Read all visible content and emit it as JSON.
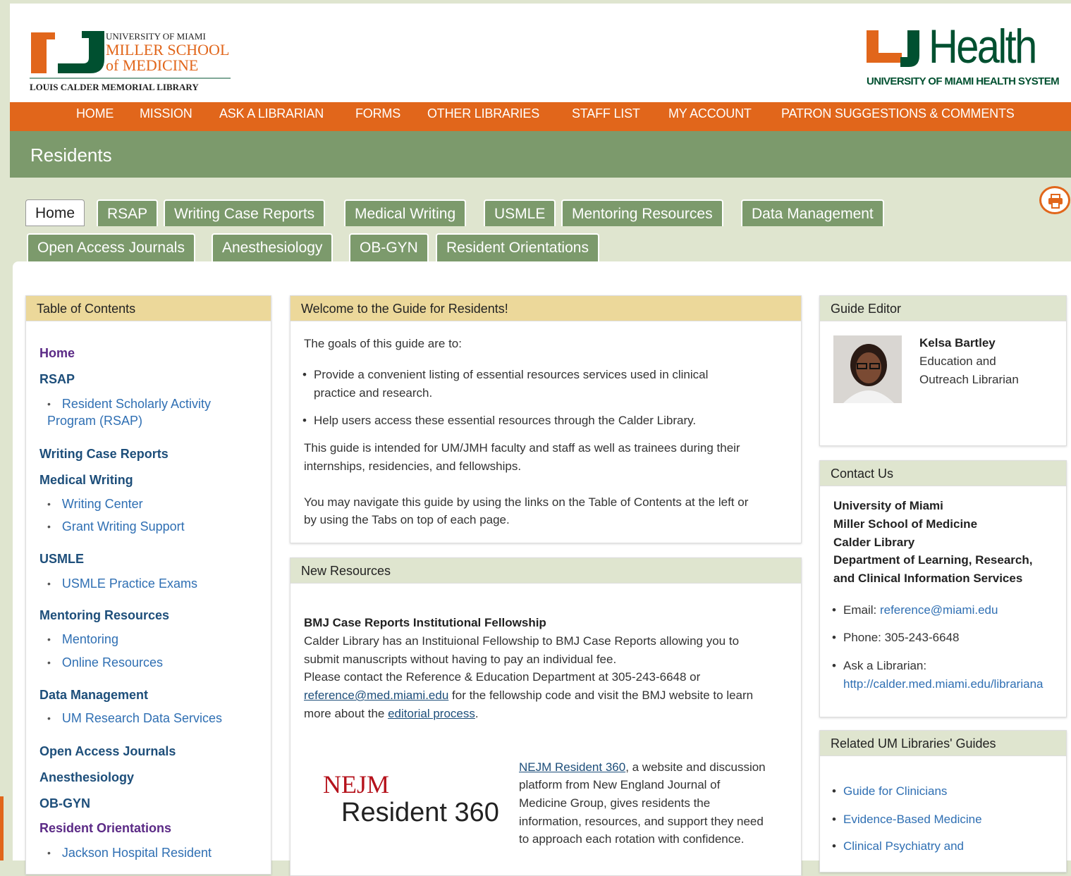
{
  "header": {
    "um_logo": {
      "line1": "UNIVERSITY OF MIAMI",
      "line2": "MILLER SCHOOL",
      "line3": "of MEDICINE",
      "line4": "LOUIS CALDER MEMORIAL LIBRARY"
    },
    "uhealth_logo": {
      "word": "Health",
      "subtitle": "UNIVERSITY OF MIAMI HEALTH SYSTEM"
    }
  },
  "nav": [
    "HOME",
    "MISSION",
    "ASK A LIBRARIAN",
    "FORMS",
    "OTHER LIBRARIES",
    "STAFF LIST",
    "MY ACCOUNT",
    "PATRON SUGGESTIONS & COMMENTS"
  ],
  "page_title": "Residents",
  "tabs_row1": [
    "Home",
    "RSAP",
    "Writing Case Reports",
    "Medical Writing",
    "USMLE",
    "Mentoring Resources",
    "Data Management"
  ],
  "tabs_row2": [
    "Open Access Journals",
    "Anesthesiology",
    "OB-GYN",
    "Resident Orientations"
  ],
  "toc": {
    "title": "Table of Contents",
    "items": {
      "home": "Home",
      "rsap": "RSAP",
      "rsap_sub1a": "Resident Scholarly Activity",
      "rsap_sub1b": "Program (RSAP)",
      "wcr": "Writing Case Reports",
      "mw": "Medical Writing",
      "mw_sub1": "Writing Center",
      "mw_sub2": "Grant Writing Support",
      "usmle": "USMLE",
      "usmle_sub1": "USMLE Practice Exams",
      "mentoring": "Mentoring Resources",
      "mentoring_sub1": "Mentoring",
      "mentoring_sub2": "Online Resources",
      "dm": "Data Management",
      "dm_sub1": "UM Research Data Services",
      "oaj": "Open Access Journals",
      "anes": "Anesthesiology",
      "obgyn": "OB-GYN",
      "ro": "Resident Orientations",
      "ro_sub1": "Jackson Hospital Resident"
    }
  },
  "welcome": {
    "title": "Welcome to the Guide for Residents!",
    "p1": "The goals of this guide are to:",
    "b1a": "Provide a convenient listing of  essential resources services used in clinical",
    "b1b": "practice and research.",
    "b2": "Help users access these essential resources through the Calder Library.",
    "p2a": "This guide is intended for UM/JMH faculty and staff as well as trainees during their",
    "p2b": "internships, residencies, and fellowships.",
    "p3a": "You may navigate this guide by using the links on the Table of Contents at the left or",
    "p3b": "by using the Tabs on top of each page."
  },
  "new_resources": {
    "title": "New Resources",
    "heading": "BMJ Case Reports Institutional Fellowship",
    "l1": "Calder Library has an Instituional Fellowship to BMJ Case Reports allowing you to",
    "l2": "submit manuscripts without having to pay an individual fee.",
    "l3": "Please contact the Reference & Education Department at 305-243-6648 or",
    "l4_link": "reference@med.miami.edu",
    "l4_rest": " for the fellowship code and visit the BMJ website to learn",
    "l5_pre": "more about the ",
    "l5_link": "editorial process",
    "l5_post": ".",
    "nejm_logo_top": "NEJM",
    "nejm_logo_bottom": "Resident 360",
    "nejm_link": "NEJM Resident 360",
    "nejm_t1": ", a website and discussion",
    "nejm_t2": "platform from New England Journal of",
    "nejm_t3": "Medicine Group, gives residents the",
    "nejm_t4": "information, resources, and support they need",
    "nejm_t5": "to approach each rotation with confidence."
  },
  "guide_editor": {
    "title": "Guide Editor",
    "name": "Kelsa Bartley",
    "role1": "Education and",
    "role2": "Outreach Librarian"
  },
  "contact": {
    "title": "Contact Us",
    "org1": "University of Miami",
    "org2": "Miller School of Medicine",
    "org3": "Calder Library",
    "org4": "Department of Learning, Research,",
    "org5": "and Clinical Information Services",
    "email_label": "Email: ",
    "email": "reference@miami.edu",
    "phone": "Phone: 305-243-6648",
    "ask_label": "Ask a Librarian:",
    "ask_url": "http://calder.med.miami.edu/librariana"
  },
  "related": {
    "title": "Related UM Libraries' Guides",
    "items": [
      "Guide for Clinicians",
      "Evidence-Based Medicine",
      "Clinical Psychiatry and"
    ]
  },
  "colors": {
    "orange": "#e1661b",
    "green": "#7c9a6c",
    "tan": "#ecd89a",
    "sage": "#dfe5cf"
  }
}
